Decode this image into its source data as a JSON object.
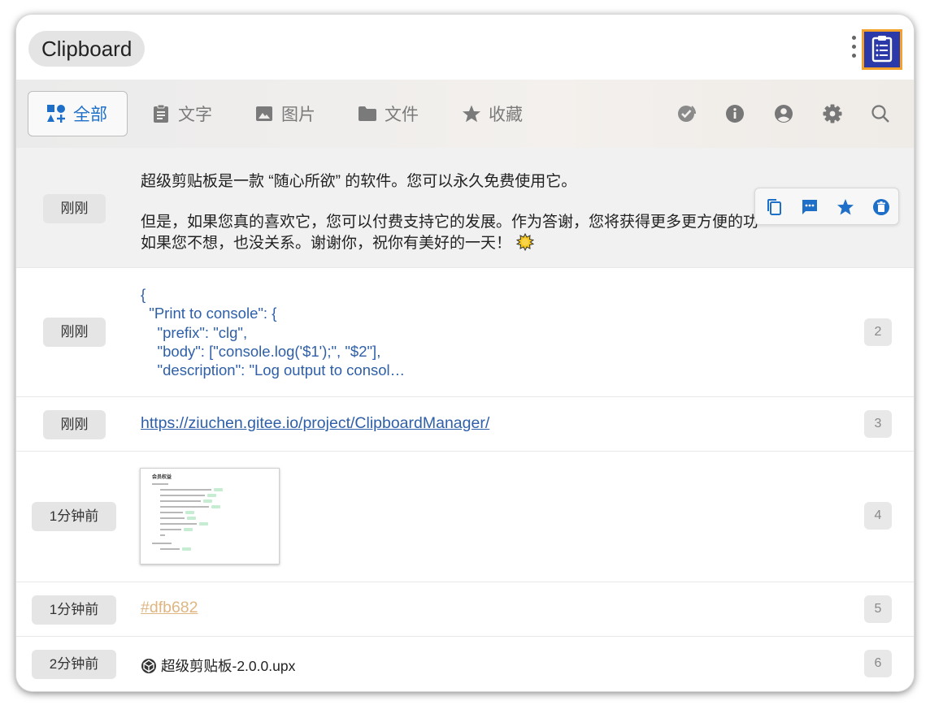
{
  "app": {
    "title": "Clipboard"
  },
  "tabs": [
    {
      "label": "全部",
      "icon": "category-icon",
      "active": true
    },
    {
      "label": "文字",
      "icon": "text-clipboard-icon"
    },
    {
      "label": "图片",
      "icon": "image-icon"
    },
    {
      "label": "文件",
      "icon": "folder-icon"
    },
    {
      "label": "收藏",
      "icon": "star-icon"
    }
  ],
  "toolbar_icons": [
    "select-all-icon",
    "info-icon",
    "account-icon",
    "settings-icon",
    "search-icon"
  ],
  "row_actions": [
    "copy-icon",
    "comment-icon",
    "favorite-star-icon",
    "delete-icon"
  ],
  "items": [
    {
      "time": "刚刚",
      "line1": "超级剪贴板是一款 “随心所欲” 的软件。您可以永久免费使用它。",
      "line2": "但是，如果您真的喜欢它，您可以付费支持它的发展。作为答谢，您将获得更多更方便的功",
      "line3": "如果您不想，也没关系。谢谢你，祝你有美好的一天！"
    },
    {
      "time": "刚刚",
      "code": "{\n  \"Print to console\": {\n    \"prefix\": \"clg\",\n    \"body\": [\"console.log('$1');\", \"$2\"],\n    \"description\": \"Log output to consol…",
      "index": "2"
    },
    {
      "time": "刚刚",
      "link": "https://ziuchen.gitee.io/project/ClipboardManager/",
      "index": "3"
    },
    {
      "time": "1分钟前",
      "image_title": "会员权益",
      "index": "4"
    },
    {
      "time": "1分钟前",
      "color": "#dfb682",
      "index": "5"
    },
    {
      "time": "2分钟前",
      "file": "超级剪贴板-2.0.0.upx",
      "index": "6"
    }
  ],
  "colors": {
    "accent": "#1d6fc7",
    "link": "#2e5fa8",
    "app_icon_bg": "#2b3aa8",
    "app_icon_border": "#f2a12a"
  }
}
